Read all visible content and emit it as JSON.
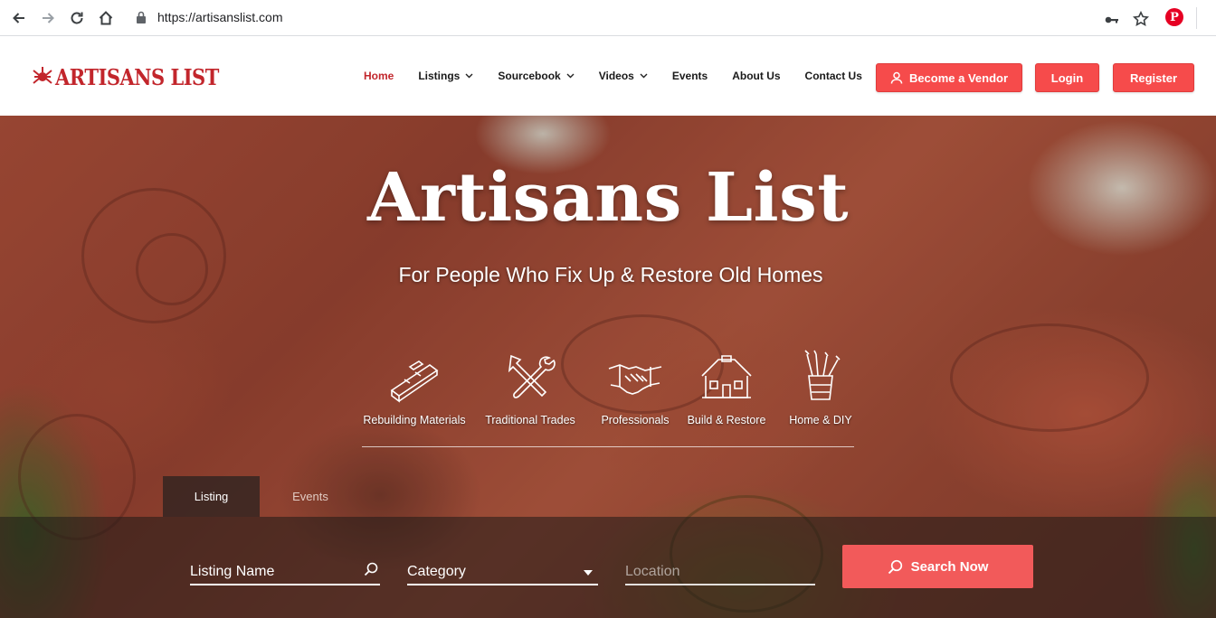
{
  "browser": {
    "url": "https://artisanslist.com",
    "icons": [
      "back-icon",
      "forward-icon",
      "reload-icon",
      "home-icon",
      "lock-icon",
      "key-icon",
      "star-icon",
      "pinterest-icon"
    ]
  },
  "header": {
    "logo_text": "ARTISANS LIST",
    "nav": [
      {
        "label": "Home",
        "active": true
      },
      {
        "label": "Listings",
        "dropdown": true
      },
      {
        "label": "Sourcebook",
        "dropdown": true
      },
      {
        "label": "Videos",
        "dropdown": true
      },
      {
        "label": "Events"
      },
      {
        "label": "About Us"
      },
      {
        "label": "Contact Us"
      }
    ],
    "buttons": {
      "vendor": "Become a Vendor",
      "login": "Login",
      "register": "Register"
    },
    "accent_color": "#c2262c",
    "button_color": "#f64b4b"
  },
  "hero": {
    "title": "Artisans List",
    "subtitle": "For People Who Fix Up & Restore Old Homes",
    "categories": [
      {
        "label": "Rebuilding Materials",
        "icon": "lumber-icon"
      },
      {
        "label": "Traditional Trades",
        "icon": "tools-icon"
      },
      {
        "label": "Professionals",
        "icon": "handshake-icon"
      },
      {
        "label": "Build & Restore",
        "icon": "house-icon"
      },
      {
        "label": "Home & DIY",
        "icon": "brush-cup-icon"
      }
    ]
  },
  "search": {
    "tabs": [
      "Listing",
      "Events"
    ],
    "active_tab": "Listing",
    "listing_name_placeholder": "Listing Name",
    "category_placeholder": "Category",
    "location_placeholder": "Location",
    "button": "Search Now"
  }
}
